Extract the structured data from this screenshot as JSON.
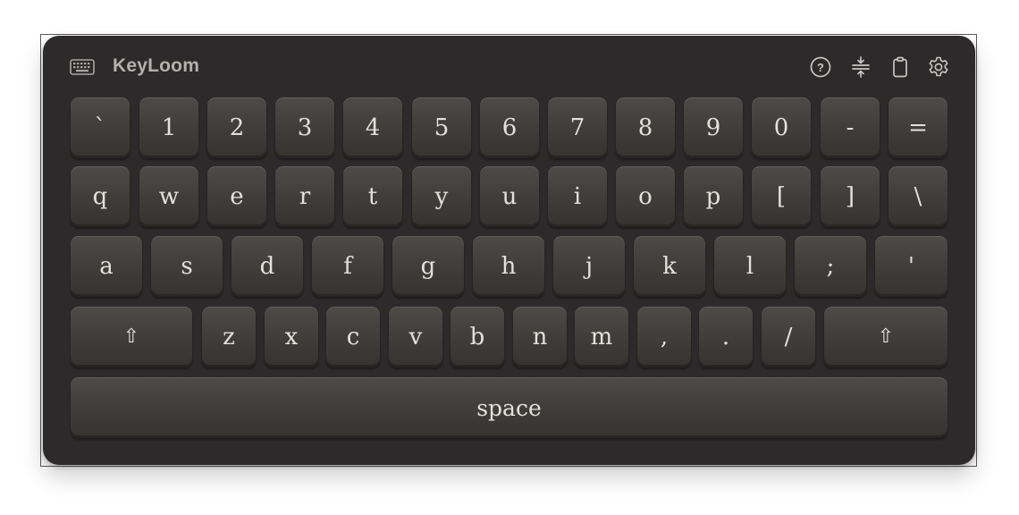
{
  "app": {
    "title": "KeyLoom",
    "icon": "keyboard-icon"
  },
  "toolbar": {
    "tools": [
      {
        "name": "help-icon"
      },
      {
        "name": "split-icon"
      },
      {
        "name": "clipboard-icon"
      },
      {
        "name": "settings-icon"
      }
    ]
  },
  "rows": {
    "number": [
      "`",
      "1",
      "2",
      "3",
      "4",
      "5",
      "6",
      "7",
      "8",
      "9",
      "0",
      "-",
      "="
    ],
    "top": [
      "q",
      "w",
      "e",
      "r",
      "t",
      "y",
      "u",
      "i",
      "o",
      "p",
      "[",
      "]",
      "\\"
    ],
    "home": [
      "a",
      "s",
      "d",
      "f",
      "g",
      "h",
      "j",
      "k",
      "l",
      ";",
      "'"
    ],
    "bottom": [
      "⇧",
      "z",
      "x",
      "c",
      "v",
      "b",
      "n",
      "m",
      ",",
      ".",
      "/",
      "⇧"
    ],
    "space": "space"
  },
  "colors": {
    "keyboard_bg": "#2c2a2a",
    "key_face": "#403d3b",
    "key_text": "#e4e0db",
    "title_text": "#b3b0ad"
  }
}
